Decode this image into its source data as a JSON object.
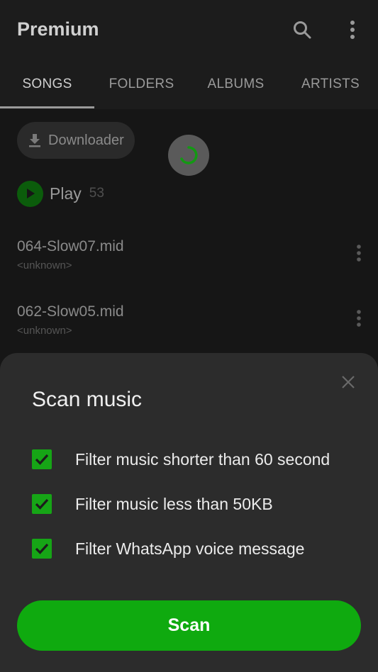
{
  "appbar": {
    "title": "Premium",
    "search_icon": "search-icon",
    "more_icon": "more-vert-icon"
  },
  "tabs": [
    {
      "label": "SONGS",
      "active": true
    },
    {
      "label": "FOLDERS",
      "active": false
    },
    {
      "label": "ALBUMS",
      "active": false
    },
    {
      "label": "ARTISTS",
      "active": false
    }
  ],
  "downloader": {
    "label": "Downloader",
    "icon": "download-icon"
  },
  "play": {
    "label": "Play",
    "count": "53"
  },
  "songs": [
    {
      "name": "064-Slow07.mid",
      "artist": "<unknown>"
    },
    {
      "name": "062-Slow05.mid",
      "artist": "<unknown>"
    }
  ],
  "sheet": {
    "title": "Scan music",
    "options": [
      {
        "label": "Filter music shorter than 60 second",
        "checked": true
      },
      {
        "label": "Filter music less than 50KB",
        "checked": true
      },
      {
        "label": "Filter WhatsApp voice message",
        "checked": true
      }
    ],
    "scan_label": "Scan"
  },
  "colors": {
    "accent": "#0faa0f",
    "sheet_bg": "#2c2c2c",
    "bg": "#1c1c1c"
  }
}
